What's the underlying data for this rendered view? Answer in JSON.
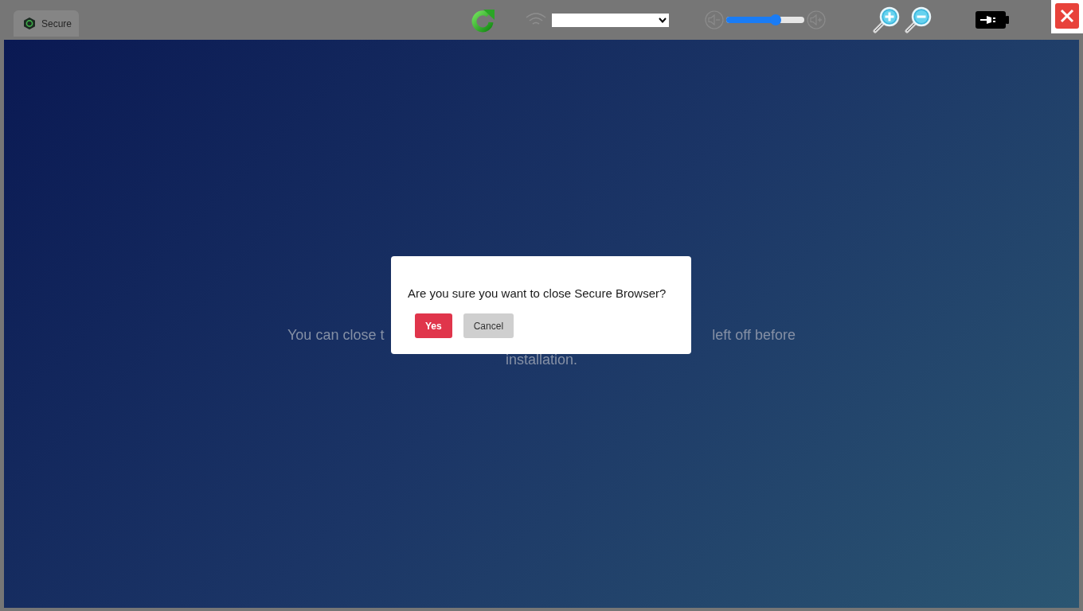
{
  "browser_tab": {
    "title": "Secure",
    "selected": true
  },
  "toolbar": {
    "volume": {
      "level": 0.63
    }
  },
  "background_message": {
    "line_1_left": "You can close t",
    "line_1_right": "left off before",
    "line_2": "installation."
  },
  "dialog": {
    "message": "Are you sure you want to close Secure Browser?",
    "buttons": [
      {
        "label": "Yes",
        "kind": "primary"
      },
      {
        "label": "Cancel",
        "kind": "secondary"
      }
    ]
  }
}
